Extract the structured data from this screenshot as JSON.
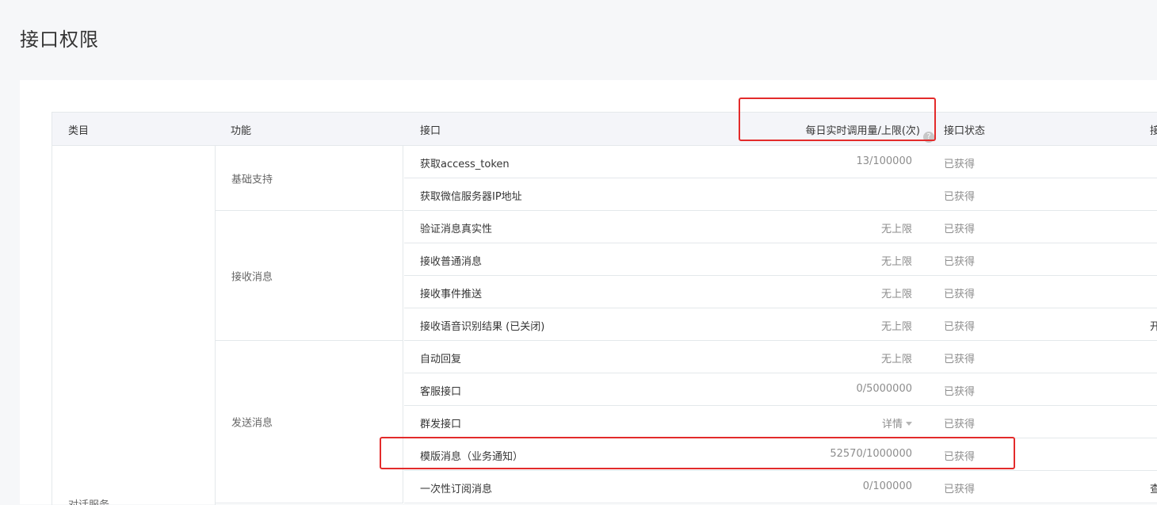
{
  "page": {
    "title": "接口权限"
  },
  "table": {
    "headers": {
      "category": "类目",
      "function": "功能",
      "api": "接口",
      "daily_limit": "每日实时调用量/上限(次)",
      "status": "接口状态",
      "extra": "接"
    },
    "category_label": "对话服务",
    "groups": [
      {
        "label": "基础支持"
      },
      {
        "label": "接收消息"
      },
      {
        "label": "发送消息"
      }
    ],
    "rows": [
      {
        "api": "获取access_token",
        "limit": "13/100000",
        "status": "已获得",
        "extra": ""
      },
      {
        "api": "获取微信服务器IP地址",
        "limit": "",
        "status": "已获得",
        "extra": ""
      },
      {
        "api": "验证消息真实性",
        "limit": "无上限",
        "status": "已获得",
        "extra": ""
      },
      {
        "api": "接收普通消息",
        "limit": "无上限",
        "status": "已获得",
        "extra": ""
      },
      {
        "api": "接收事件推送",
        "limit": "无上限",
        "status": "已获得",
        "extra": ""
      },
      {
        "api": "接收语音识别结果 (已关闭)",
        "limit": "无上限",
        "status": "已获得",
        "extra": "开"
      },
      {
        "api": "自动回复",
        "limit": "无上限",
        "status": "已获得",
        "extra": ""
      },
      {
        "api": "客服接口",
        "limit": "0/5000000",
        "status": "已获得",
        "extra": ""
      },
      {
        "api": "群发接口",
        "limit": "详情",
        "status": "已获得",
        "extra": ""
      },
      {
        "api": "模版消息（业务通知）",
        "limit": "52570/1000000",
        "status": "已获得",
        "extra": ""
      },
      {
        "api": "一次性订阅消息",
        "limit": "0/100000",
        "status": "已获得",
        "extra": "查看模版"
      }
    ]
  },
  "colors": {
    "highlight": "#e32b2b",
    "header_bg": "#f4f5f9",
    "border": "#e4e8eb"
  },
  "icons": {
    "help": "question-circle-icon",
    "dropdown": "caret-down-icon"
  }
}
